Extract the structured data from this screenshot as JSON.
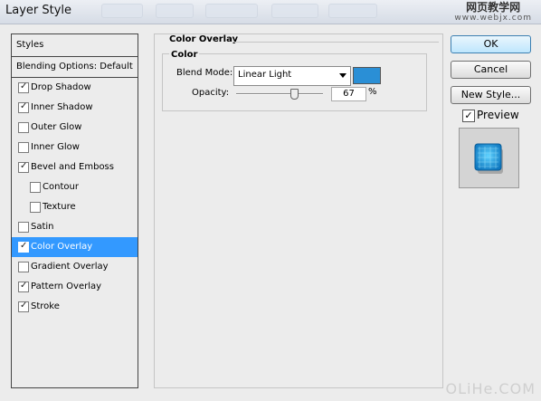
{
  "window": {
    "title": "Layer Style",
    "watermark_top_cn": "网页教学网",
    "watermark_top_url": "www.webjx.com",
    "watermark_bottom": "OLiHe.COM"
  },
  "left": {
    "styles_label": "Styles",
    "blending_label": "Blending Options: Default",
    "items": [
      {
        "label": "Drop Shadow",
        "checked": true,
        "sub": false
      },
      {
        "label": "Inner Shadow",
        "checked": true,
        "sub": false
      },
      {
        "label": "Outer Glow",
        "checked": false,
        "sub": false
      },
      {
        "label": "Inner Glow",
        "checked": false,
        "sub": false
      },
      {
        "label": "Bevel and Emboss",
        "checked": true,
        "sub": false
      },
      {
        "label": "Contour",
        "checked": false,
        "sub": true
      },
      {
        "label": "Texture",
        "checked": false,
        "sub": true
      },
      {
        "label": "Satin",
        "checked": false,
        "sub": false
      },
      {
        "label": "Color Overlay",
        "checked": true,
        "sub": false,
        "selected": true
      },
      {
        "label": "Gradient Overlay",
        "checked": false,
        "sub": false
      },
      {
        "label": "Pattern Overlay",
        "checked": true,
        "sub": false
      },
      {
        "label": "Stroke",
        "checked": true,
        "sub": false
      }
    ]
  },
  "panel": {
    "section_title": "Color Overlay",
    "group_title": "Color",
    "blend_mode_label": "Blend Mode:",
    "blend_mode_value": "Linear Light",
    "overlay_color": "#2a8fd6",
    "opacity_label": "Opacity:",
    "opacity_value": "67",
    "opacity_unit": "%",
    "opacity_fraction": 0.67
  },
  "buttons": {
    "ok": "OK",
    "cancel": "Cancel",
    "new_style": "New Style...",
    "preview_label": "Preview",
    "preview_checked": true
  },
  "colors": {
    "accent": "#3399ff",
    "preview_tile": "#1f9fe0"
  }
}
